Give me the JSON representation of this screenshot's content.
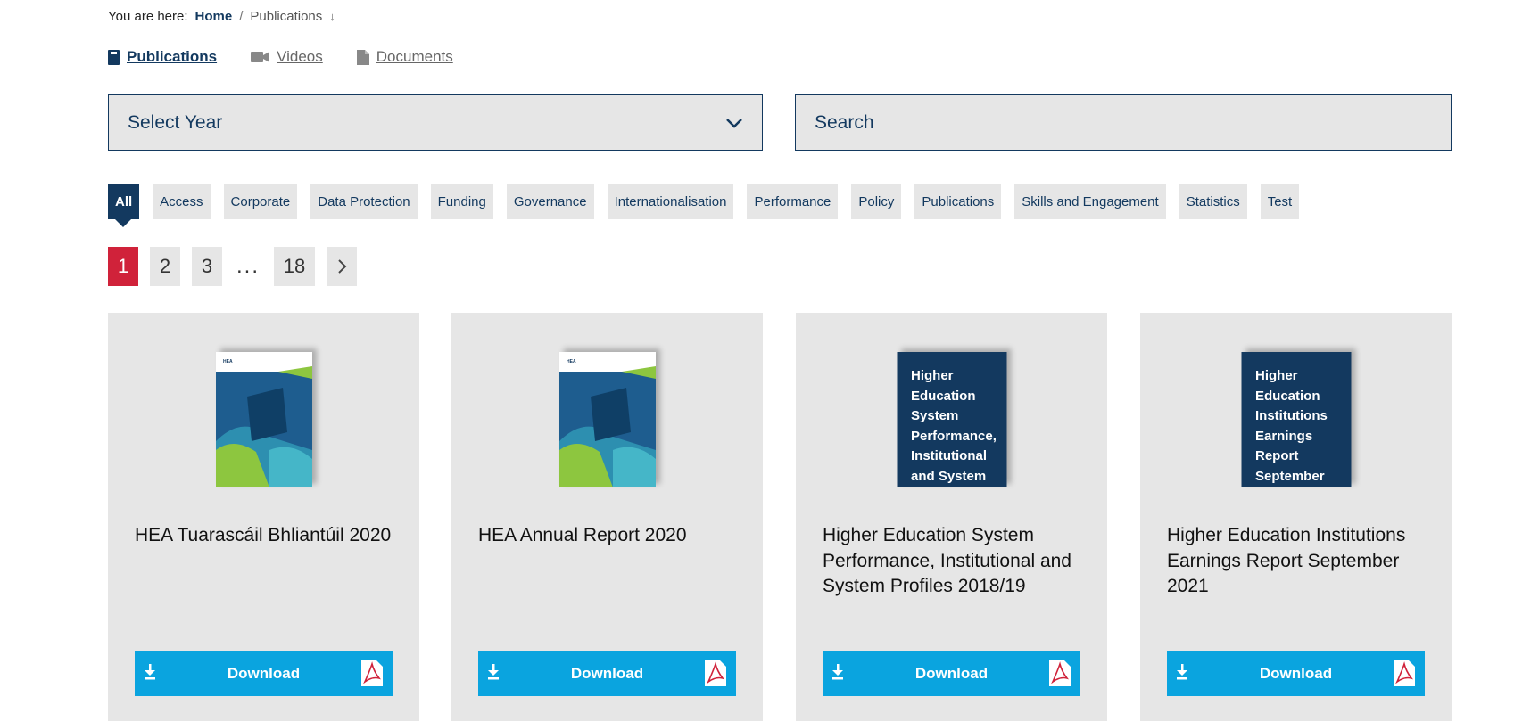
{
  "breadcrumb": {
    "prefix": "You are here:",
    "home": "Home",
    "separator": "/",
    "current": "Publications",
    "arrow": "↓"
  },
  "type_tabs": [
    {
      "label": "Publications",
      "icon": "book-icon",
      "active": true
    },
    {
      "label": "Videos",
      "icon": "video-camera-icon",
      "active": false
    },
    {
      "label": "Documents",
      "icon": "document-icon",
      "active": false
    }
  ],
  "filters": {
    "year_select_label": "Select Year",
    "search_placeholder": "Search"
  },
  "categories": [
    "All",
    "Access",
    "Corporate",
    "Data Protection",
    "Funding",
    "Governance",
    "Internationalisation",
    "Performance",
    "Policy",
    "Publications",
    "Skills and Engagement",
    "Statistics",
    "Test"
  ],
  "active_category": "All",
  "pagination": {
    "pages": [
      "1",
      "2",
      "3"
    ],
    "ellipsis": "...",
    "last": "18",
    "current": "1"
  },
  "cards": [
    {
      "title": "HEA Tuarascáil Bhliantúil 2020",
      "cover": "image",
      "button": "Download"
    },
    {
      "title": "HEA Annual Report 2020",
      "cover": "image",
      "button": "Download"
    },
    {
      "title": "Higher Education System Performance, Institutional and System Profiles 2018/19",
      "cover": "text",
      "cover_text": "Higher Education System Performance, Institutional and System",
      "button": "Download"
    },
    {
      "title": "Higher Education Institutions Earnings Report September 2021",
      "cover": "text",
      "cover_text": "Higher Education Institutions Earnings Report September",
      "button": "Download"
    }
  ],
  "colors": {
    "navy": "#13395f",
    "accent_red": "#d0223a",
    "download_blue": "#0aa4df",
    "panel_grey": "#e6e6e6"
  }
}
